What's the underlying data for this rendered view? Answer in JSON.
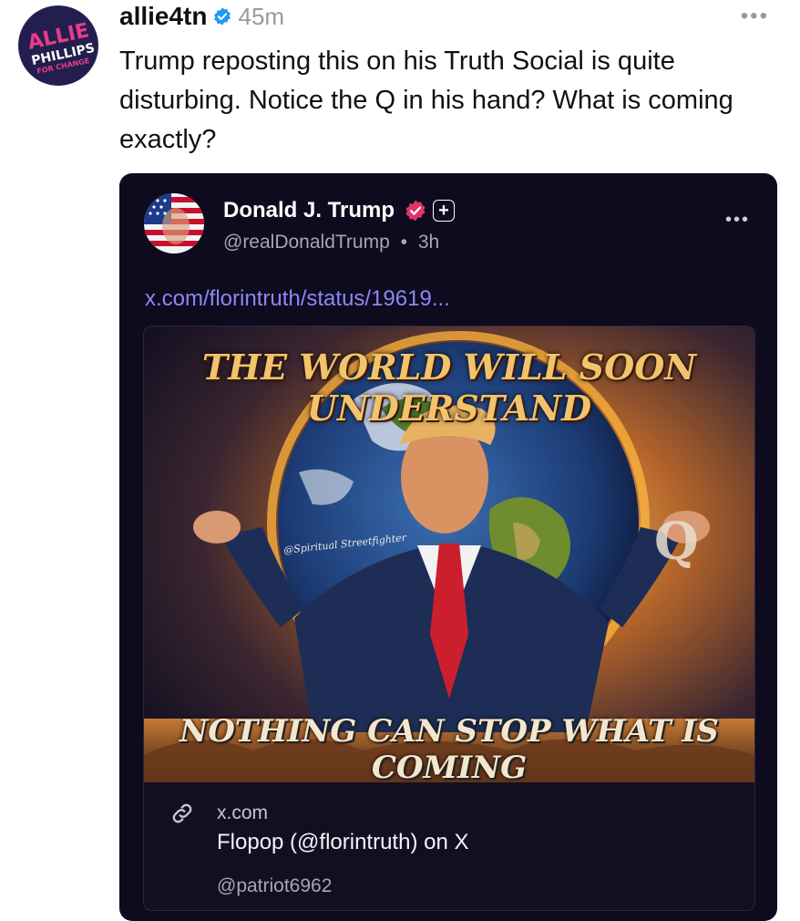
{
  "post": {
    "author": "allie4tn",
    "time": "45m",
    "avatar_lines": [
      "ALLIE",
      "PHILLIPS",
      "FOR CHANGE"
    ],
    "text": "Trump reposting this on his Truth Social is quite disturbing. Notice the Q in his hand?  What is coming exactly?",
    "more_icon": "•••"
  },
  "quoted": {
    "name": "Donald J. Trump",
    "handle": "@realDonaldTrump",
    "time": "3h",
    "separator": "•",
    "more_icon": "•••",
    "plus_icon": "+",
    "link": "x.com/florintruth/status/19619...",
    "image": {
      "headline": "THE WORLD WILL SOON UNDERSTAND",
      "footer": "NOTHING CAN STOP WHAT IS COMING",
      "watermark": "@Spiritual Streetfighter"
    },
    "link_card": {
      "domain": "x.com",
      "title": "Flopop (@florintruth) on X",
      "handle": "@patriot6962"
    }
  },
  "colors": {
    "verified_blue": "#1d9bf0",
    "truth_badge_pink": "#e0336c",
    "link_purple": "#8f86f5",
    "card_background": "#0d0b1d"
  }
}
